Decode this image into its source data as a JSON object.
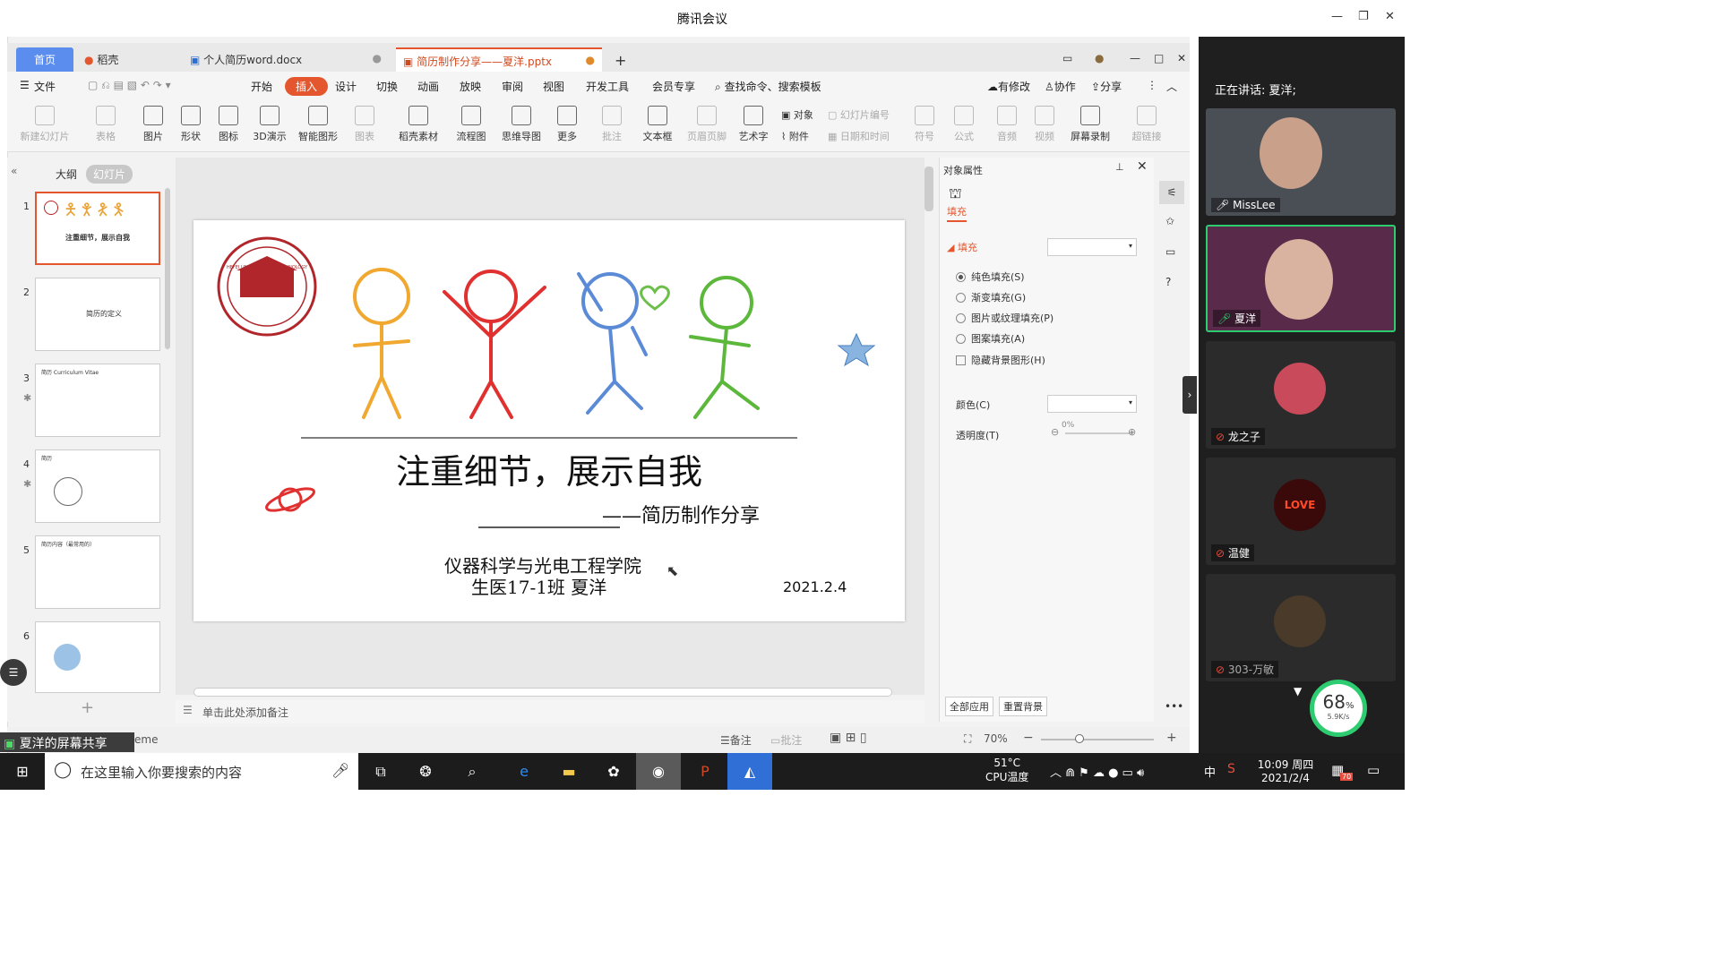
{
  "window": {
    "title": "腾讯会议"
  },
  "tabs": {
    "home": "首页",
    "straw": "稻壳",
    "doc": "个人简历word.docx",
    "active": "简历制作分享——夏洋.pptx"
  },
  "menu": {
    "file": "文件",
    "items": [
      "开始",
      "插入",
      "设计",
      "切换",
      "动画",
      "放映",
      "审阅",
      "视图",
      "开发工具",
      "会员专享"
    ],
    "search": "查找命令、搜索模板",
    "changes": "有修改",
    "collab": "协作",
    "share": "分享"
  },
  "ribbon": {
    "new_slide": "新建幻灯片",
    "table": "表格",
    "picture": "图片",
    "shape": "形状",
    "icon": "图标",
    "d3": "3D演示",
    "smart": "智能图形",
    "chart": "图表",
    "straw_mat": "稻壳素材",
    "flow": "流程图",
    "mind": "思维导图",
    "more": "更多",
    "comment": "批注",
    "textbox": "文本框",
    "header": "页眉页脚",
    "art": "艺术字",
    "object": "对象",
    "attach": "附件",
    "slide_no": "幻灯片编号",
    "datetime": "日期和时间",
    "symbol": "符号",
    "formula": "公式",
    "audio": "音频",
    "video": "视频",
    "record": "屏幕录制",
    "hyperlink": "超链接"
  },
  "outline": {
    "outline_tab": "大纲",
    "slides_tab": "幻灯片",
    "numbers": [
      "1",
      "2",
      "3",
      "4",
      "5",
      "6"
    ],
    "t1_title": "注重细节，展示自我",
    "t2_title": "简历的定义",
    "t3_title": "简历 Curriculum Vitae",
    "t4_title": "简历",
    "t5_title": "简历内容（最常用的）"
  },
  "slide": {
    "title": "注重细节，展示自我",
    "subtitle": "——简历制作分享",
    "school": "仪器科学与光电工程学院",
    "klass": "生医17-1班  夏洋",
    "date": "2021.2.4",
    "seal_text": "HEFEI UNIVERSITY OF TECHNOLOGY",
    "seal_year": "1945"
  },
  "notes": {
    "placeholder": "单击此处添加备注"
  },
  "props": {
    "title": "对象属性",
    "fill_tab": "填充",
    "fill_section": "填充",
    "solid": "纯色填充(S)",
    "gradient": "渐变填充(G)",
    "picture": "图片或纹理填充(P)",
    "pattern": "图案填充(A)",
    "hide_bg": "隐藏背景图形(H)",
    "color": "颜色(C)",
    "transparency": "透明度(T)",
    "trans_val": "0%",
    "apply_all": "全部应用",
    "reset_bg": "重置背景"
  },
  "status": {
    "share": "夏洋的屏幕共享",
    "theme": "eme",
    "notes": "备注",
    "comment": "批注",
    "zoom": "70%"
  },
  "meeting": {
    "speaking": "正在讲话: 夏洋;",
    "p1": "MissLee",
    "p2": "夏洋",
    "p3": "龙之子",
    "p4": "温健",
    "p5": "303-万敏",
    "love": "LOVE",
    "net_pct": "68",
    "net_unit": "%",
    "net_speed": "5.9K/s"
  },
  "taskbar": {
    "search": "在这里输入你要搜索的内容",
    "temp": "51°C",
    "cpu": "CPU温度",
    "time": "10:09 周四",
    "date": "2021/2/4",
    "ime": "中",
    "badge": "70"
  }
}
